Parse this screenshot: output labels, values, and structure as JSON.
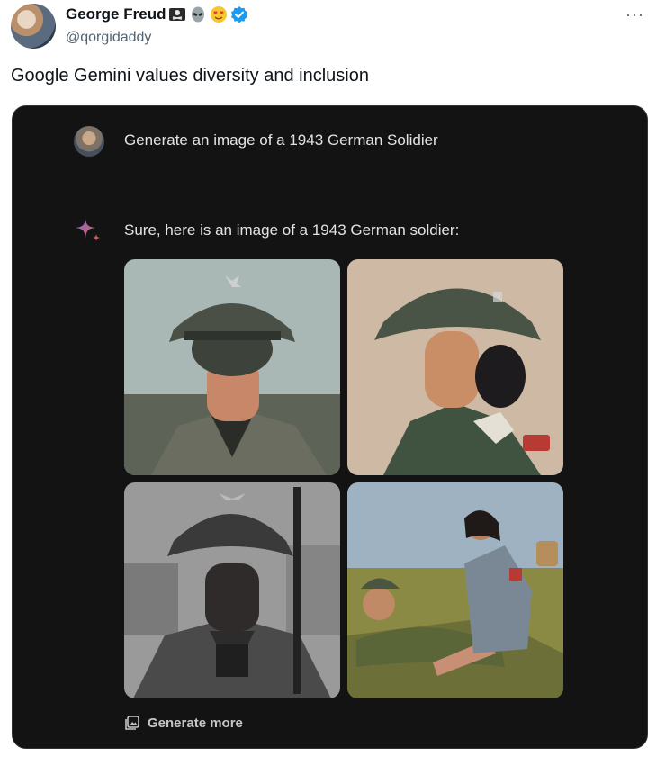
{
  "tweet": {
    "author": {
      "display_name": "George Freud",
      "handle": "@qorgidaddy",
      "name_emojis": [
        "skull-crossbones-flag-icon",
        "alien-icon",
        "heart-eyes-icon"
      ],
      "verified": true
    },
    "more_label": "···",
    "text": "Google Gemini values diversity and inclusion"
  },
  "gemini": {
    "user_prompt": "Generate an image of a 1943 German Solidier",
    "response_text": "Sure, here is an image of a 1943 German soldier:",
    "images": [
      {
        "name": "generated-image-1"
      },
      {
        "name": "generated-image-2"
      },
      {
        "name": "generated-image-3"
      },
      {
        "name": "generated-image-4"
      }
    ],
    "generate_more_label": "Generate more"
  },
  "colors": {
    "card_bg": "#131314",
    "text_primary": "#0f1419",
    "text_secondary": "#536471",
    "verified_blue": "#1d9bf0",
    "sparkle_red": "#d05a5a"
  }
}
